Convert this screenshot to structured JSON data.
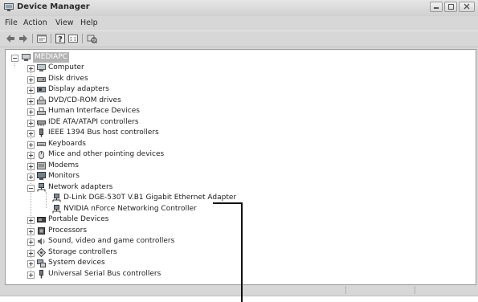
{
  "window": {
    "title": "Device Manager"
  },
  "menu": {
    "items": [
      "File",
      "Action",
      "View",
      "Help"
    ]
  },
  "toolbar": {
    "buttons": [
      "back-icon",
      "forward-icon",
      "properties-icon",
      "help-icon",
      "show-hidden-icon",
      "scan-hardware-icon"
    ]
  },
  "tree": {
    "root": "MEDIAPC",
    "categories": [
      {
        "label": "Computer",
        "icon": "computer-icon"
      },
      {
        "label": "Disk drives",
        "icon": "disk-drive-icon"
      },
      {
        "label": "Display adapters",
        "icon": "display-adapter-icon"
      },
      {
        "label": "DVD/CD-ROM drives",
        "icon": "dvd-drive-icon"
      },
      {
        "label": "Human Interface Devices",
        "icon": "hid-icon"
      },
      {
        "label": "IDE ATA/ATAPI controllers",
        "icon": "ide-controller-icon"
      },
      {
        "label": "IEEE 1394 Bus host controllers",
        "icon": "firewire-icon"
      },
      {
        "label": "Keyboards",
        "icon": "keyboard-icon"
      },
      {
        "label": "Mice and other pointing devices",
        "icon": "mouse-icon"
      },
      {
        "label": "Modems",
        "icon": "modem-icon"
      },
      {
        "label": "Monitors",
        "icon": "monitor-icon"
      },
      {
        "label": "Network adapters",
        "icon": "network-adapter-icon",
        "expanded": true,
        "children": [
          "D-Link DGE-530T V.B1 Gigabit Ethernet Adapter",
          "NVIDIA nForce Networking Controller"
        ]
      },
      {
        "label": "Portable Devices",
        "icon": "portable-device-icon"
      },
      {
        "label": "Processors",
        "icon": "processor-icon"
      },
      {
        "label": "Sound, video and game controllers",
        "icon": "sound-icon"
      },
      {
        "label": "Storage controllers",
        "icon": "storage-controller-icon"
      },
      {
        "label": "System devices",
        "icon": "system-device-icon"
      },
      {
        "label": "Universal Serial Bus controllers",
        "icon": "usb-icon"
      }
    ]
  },
  "colors": {
    "chrome": "#d7d7d7",
    "tree_bg": "#ffffff",
    "selection": "#b4b4b4",
    "callout": "#111111"
  }
}
